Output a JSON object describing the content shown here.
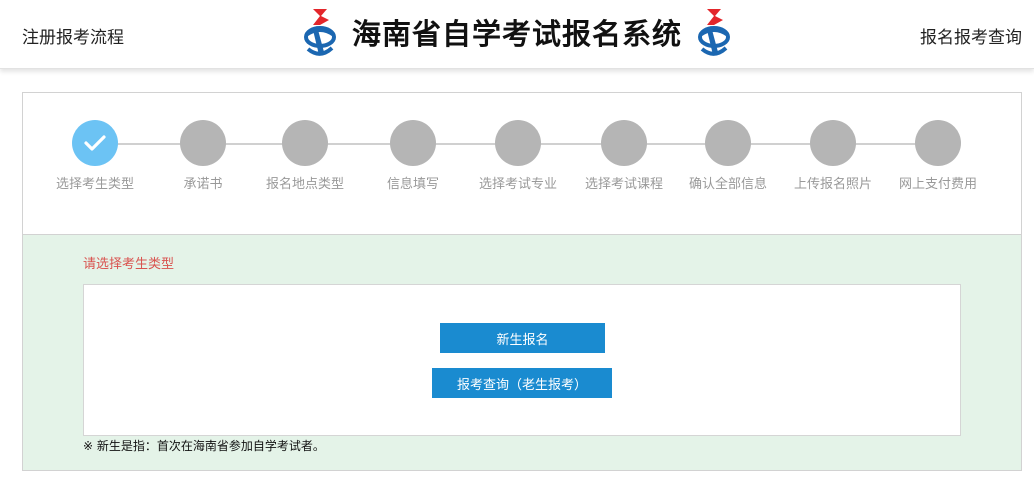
{
  "header": {
    "left_link": "注册报考流程",
    "title": "海南省自学考试报名系统",
    "right_link": "报名报考查询",
    "logo_icon": "exam-system-logo-icon",
    "logo_colors": {
      "red": "#e3262b",
      "blue": "#1b67b1"
    }
  },
  "steps": {
    "items": [
      {
        "label": "选择考生类型",
        "status": "done"
      },
      {
        "label": "承诺书",
        "status": "pending"
      },
      {
        "label": "报名地点类型",
        "status": "pending"
      },
      {
        "label": "信息填写",
        "status": "pending"
      },
      {
        "label": "选择考试专业",
        "status": "pending"
      },
      {
        "label": "选择考试课程",
        "status": "pending"
      },
      {
        "label": "确认全部信息",
        "status": "pending"
      },
      {
        "label": "上传报名照片",
        "status": "pending"
      },
      {
        "label": "网上支付费用",
        "status": "pending"
      }
    ],
    "done_icon": "checkmark-icon",
    "colors": {
      "done": "#6cc3f4",
      "pending": "#b5b5b5"
    }
  },
  "main": {
    "prompt": "请选择考生类型",
    "new_button": "新生报名",
    "old_button": "报考查询（老生报考）",
    "note": "※ 新生是指：首次在海南省参加自学考试者。",
    "colors": {
      "button": "#1a8bd0",
      "panel_bg": "#e4f3e8",
      "prompt": "#d9534f"
    }
  }
}
